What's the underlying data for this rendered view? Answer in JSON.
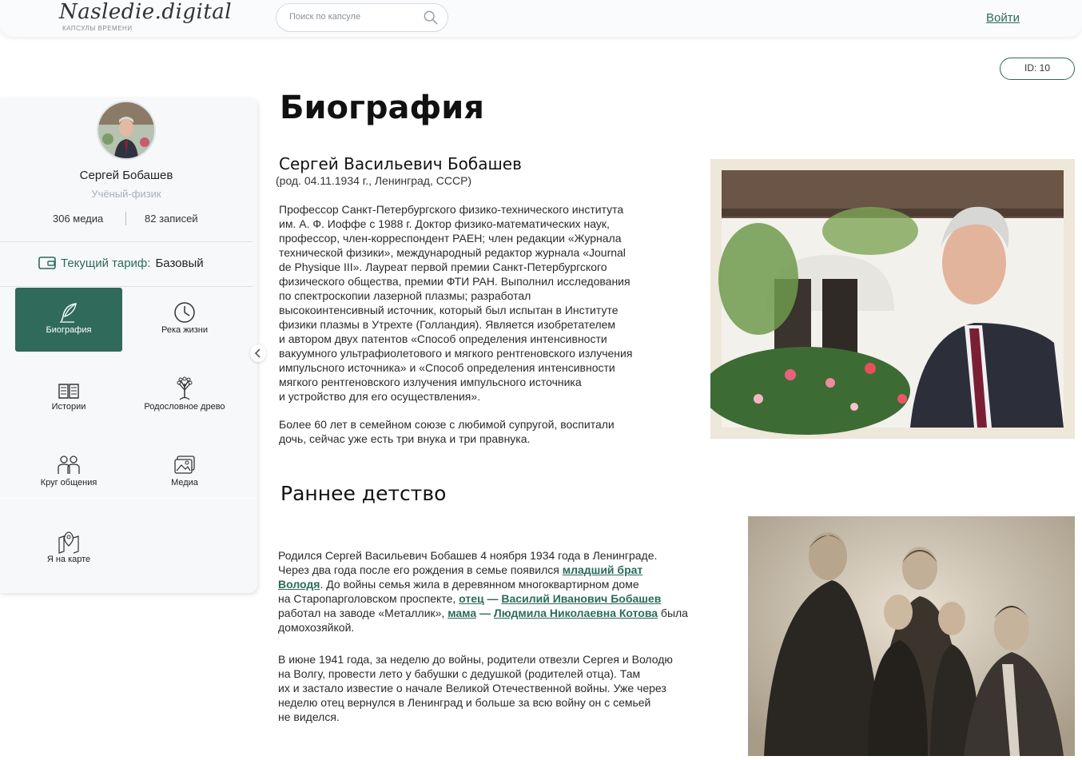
{
  "header": {
    "logo_main": "Nasledie.digital",
    "logo_sub": "КАПСУЛЫ ВРЕМЕНИ",
    "search_placeholder": "Поиск по капсуле",
    "login_label": "Войти"
  },
  "capsule_id": "ID: 10",
  "profile": {
    "name": "Сергей Бобашев",
    "role": "Учёный-физик",
    "media_count": "306 медиа",
    "posts_count": "82 записей",
    "tariff_label": "Текущий тариф:",
    "tariff_value": "Базовый"
  },
  "nav": [
    {
      "label": "Биография",
      "icon": "feather-icon",
      "active": true
    },
    {
      "label": "Река жизни",
      "icon": "clock-icon"
    },
    {
      "label": "Истории",
      "icon": "book-icon"
    },
    {
      "label": "Родословное древо",
      "icon": "tree-icon"
    },
    {
      "label": "Круг общения",
      "icon": "people-icon"
    },
    {
      "label": "Медиа",
      "icon": "photos-icon"
    },
    {
      "label": "Я на карте",
      "icon": "map-pin-icon"
    }
  ],
  "content": {
    "title": "Биография",
    "person_name": "Сергей Васильевич Бобашев",
    "person_born": "(род. 04.11.1934 г., Ленинград, СССР)",
    "bio_lines": [
      "Профессор Санкт-Петербургского физико-технического института",
      "им. А. Ф. Иоффе с 1988 г. Доктор физико-математических наук,",
      "профессор, член-корреспондент РАЕН; член редакции «Журнала",
      "технической физики», международный редактор журнала «Journal",
      "de Physique III». Лауреат первой премии Санкт-Петербургского",
      "физического общества, премии ФТИ РАН. Выполнил исследования",
      "по спектроскопии лазерной плазмы; разработал",
      "высокоинтенсивный источник, который был испытан в Институте",
      "физики плазмы в Утрехте (Голландия). Является изобретателем",
      "и автором двух патентов «Способ определения интенсивности",
      "вакуумного ультрафиолетового и мягкого рентгеновского излучения",
      "импульсного источника» и «Способ определения интенсивности",
      "мягкого рентгеновского излучения импульсного источника",
      "и устройство для его осуществления»."
    ],
    "family_lines": [
      "Более 60 лет в семейном союзе с любимой супругой, воспитали",
      "дочь, сейчас уже есть три внука и три правнука."
    ],
    "section_title": "Раннее детство",
    "early": {
      "l1": "Родился Сергей Васильевич Бобашев 4 ноября 1934 года в Ленинграде.",
      "l2_text": "Через два года после его рождения в семье появился ",
      "l2_link": "младший брат",
      "l3_link": "Володя",
      "l3_text": ". До войны семья жила в деревянном многоквартирном доме",
      "l4_text": "на Старопарголовском проспекте, ",
      "l4_link1": "отец",
      "l4_dash": " — ",
      "l4_link2": "Василий Иванович Бобашев",
      "l5_text": "работал на заводе «Металлик», ",
      "l5_link1": "мама",
      "l5_dash": " — ",
      "l5_link2": "Людмила Николаевна Котова",
      "l5_end": " была",
      "l6": "домохозяйкой."
    },
    "war_lines": [
      "В июне 1941 года, за неделю до войны, родители отвезли Сергея и Володю",
      "на Волгу, провести лето у бабушки с дедушкой (родителей отца). Там",
      "их и застало известие о начале Великой Отечественной войны. Уже через",
      "неделю отец вернулся в Ленинград и больше за всю войну он с семьей",
      "не виделся."
    ]
  }
}
